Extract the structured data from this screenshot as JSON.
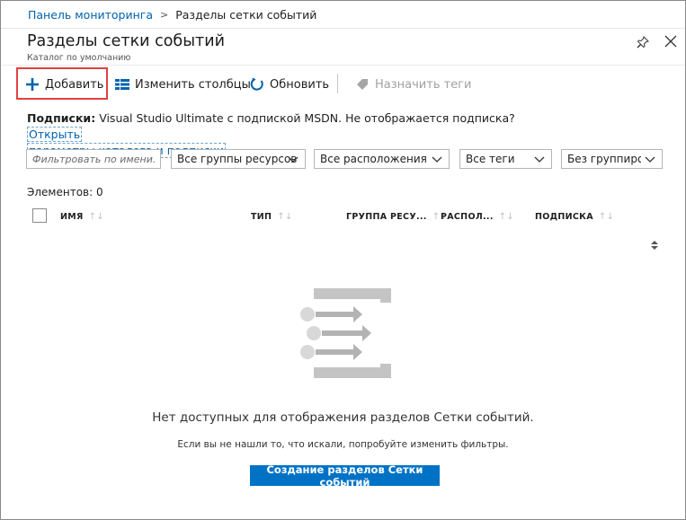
{
  "breadcrumb": {
    "root": "Панель мониторинга",
    "separator": ">",
    "current": "Разделы сетки событий"
  },
  "header": {
    "title": "Разделы сетки событий",
    "subtitle": "Каталог по умолчанию",
    "icons": [
      "pin-icon",
      "close-icon"
    ]
  },
  "toolbar": {
    "add_label": "Добавить",
    "columns_label": "Изменить столбцы",
    "refresh_label": "Обновить",
    "tags_label": "Назначить теги"
  },
  "subscriptions": {
    "label": "Подписки:",
    "text": "Visual Studio Ultimate с подпиской MSDN. Не отображается подписка?",
    "link_part1": "Открыть",
    "link_part2": "параметры каталога и подписки"
  },
  "filters": {
    "search_placeholder": "Фильтровать по имени...",
    "resource_groups": "Все группы ресурсов",
    "locations": "Все расположения",
    "tags": "Все теги",
    "grouping": "Без группиро..."
  },
  "items_count": "Элементов: 0",
  "table": {
    "columns": [
      "ИМЯ",
      "ТИП",
      "ГРУППА РЕСУ...",
      "РАСПОЛ...",
      "ПОДПИСКА"
    ]
  },
  "empty_state": {
    "title": "Нет доступных для отображения разделов Сетки событий.",
    "hint": "Если вы не нашли то, что искали, попробуйте изменить фильтры.",
    "create_button": "Создание разделов Сетки событий"
  },
  "colors": {
    "accent": "#0072c6",
    "link": "#0062ad",
    "highlight": "#e04141"
  }
}
